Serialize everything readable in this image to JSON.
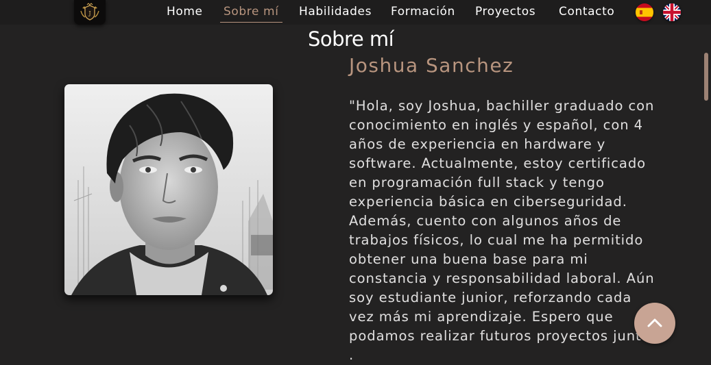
{
  "nav": {
    "items": [
      {
        "label": "Home"
      },
      {
        "label": "Sobre mí"
      },
      {
        "label": "Habilidades"
      },
      {
        "label": "Formación"
      },
      {
        "label": "Proyectos"
      },
      {
        "label": "Contacto"
      }
    ],
    "active_index": 1,
    "logo_icon": "crest-logo-icon",
    "languages": [
      {
        "icon": "spain-flag-icon"
      },
      {
        "icon": "uk-flag-icon"
      }
    ]
  },
  "about": {
    "title": "Sobre mí",
    "name": "Joshua Sanchez",
    "bio": "\"Hola, soy Joshua, bachiller graduado con conocimiento en inglés y español, con 4 años de experiencia en hardware y software. Actualmente, estoy certificado en programación full stack y tengo experiencia básica en ciberseguridad. Además, cuento con algunos años de trabajos físicos, lo cual me ha permitido obtener una buena base para mi constancia y responsabilidad laboral. Aún soy estudiante junior, reforzando cada vez más mi aprendizaje. Espero que podamos realizar futuros proyectos juntos .",
    "photo_icon": "profile-portrait-image"
  },
  "controls": {
    "scroll_top_icon": "chevron-up-icon"
  },
  "colors": {
    "background": "#232222",
    "navbar": "#1e1d1d",
    "accent": "#b8957f",
    "scroll_button": "#c8a494"
  }
}
